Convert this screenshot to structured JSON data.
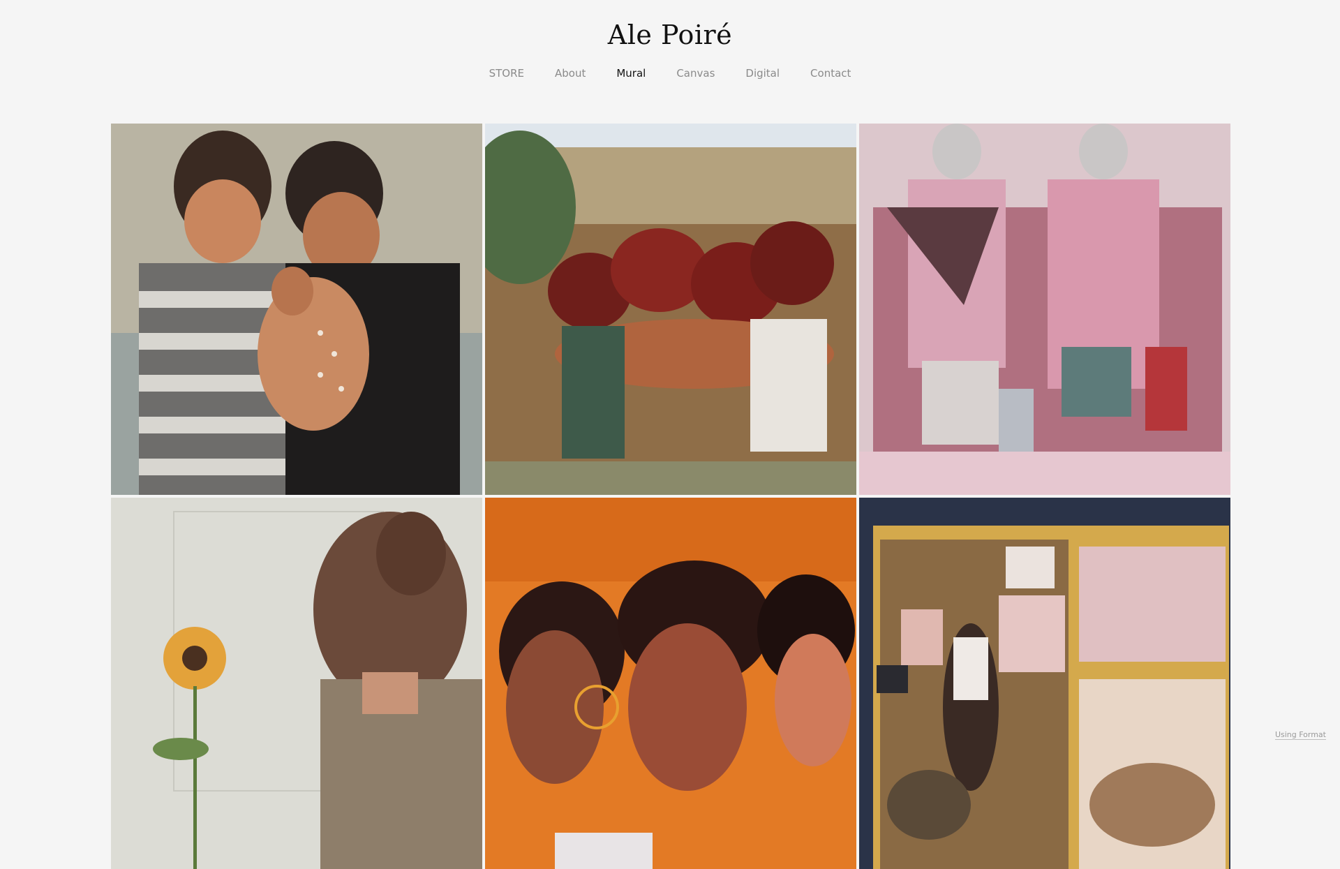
{
  "site": {
    "title": "Ale Poiré"
  },
  "nav": [
    {
      "label": "STORE",
      "active": false
    },
    {
      "label": "About",
      "active": false
    },
    {
      "label": "Mural",
      "active": true
    },
    {
      "label": "Canvas",
      "active": false
    },
    {
      "label": "Digital",
      "active": false
    },
    {
      "label": "Contact",
      "active": false
    }
  ],
  "gallery": [
    {
      "name": "mural-boys-with-fawn",
      "colors": [
        "#b9b4a3",
        "#7d7a73",
        "#3a2a22",
        "#c98a62"
      ]
    },
    {
      "name": "mural-women-embracing",
      "colors": [
        "#a88f68",
        "#7a2a22",
        "#b55a3a",
        "#4f6b44"
      ]
    },
    {
      "name": "mural-elderly-women-market",
      "colors": [
        "#d7bcc4",
        "#a15a6a",
        "#d9a4b6",
        "#5a3a3a"
      ]
    },
    {
      "name": "mural-woman-with-sunflower",
      "colors": [
        "#d9d9d2",
        "#6b4a3a",
        "#e3a23a",
        "#7a7a6a"
      ]
    },
    {
      "name": "mural-three-faces-orange",
      "colors": [
        "#e07a2a",
        "#7a3a2a",
        "#3a1e1a",
        "#d08a6a"
      ]
    },
    {
      "name": "mural-libres-protest",
      "colors": [
        "#d6a84a",
        "#6b4a2a",
        "#e8c8c8",
        "#2a2a3a"
      ]
    }
  ],
  "footer": {
    "using_format": "Using Format"
  }
}
